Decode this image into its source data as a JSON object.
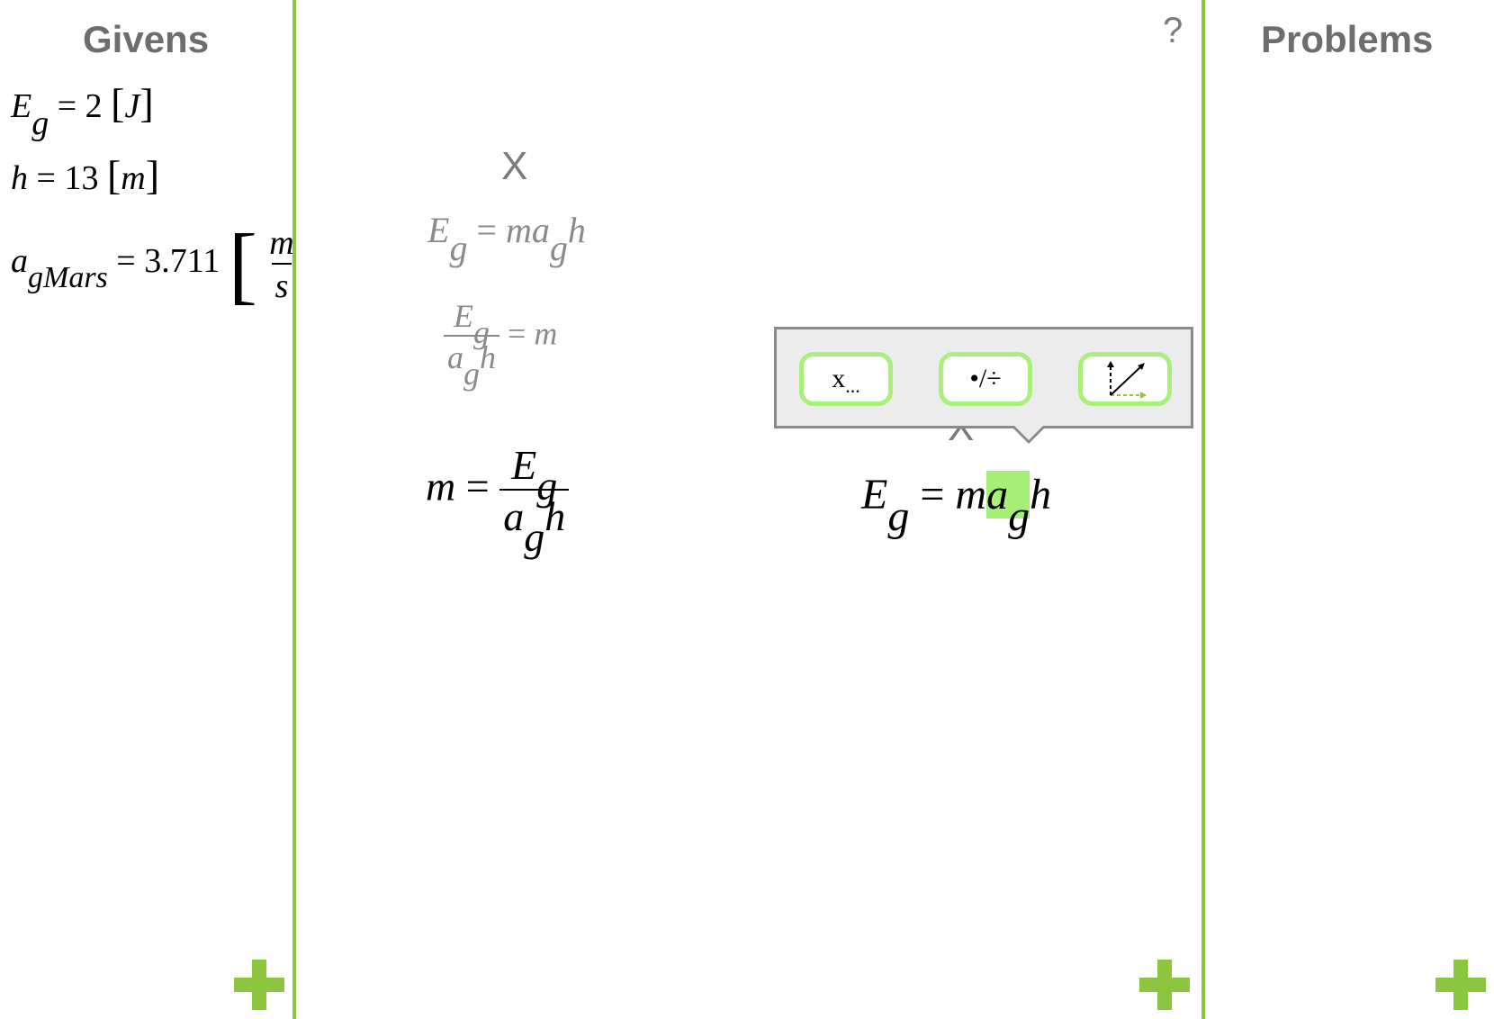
{
  "givens": {
    "title": "Givens",
    "items": [
      {
        "var": "E",
        "sub": "g",
        "eq": "=",
        "value": "2",
        "unit": "J"
      },
      {
        "var": "h",
        "sub": "",
        "eq": "=",
        "value": "13",
        "unit": "m"
      },
      {
        "var": "a",
        "sub": "gMars",
        "eq": "=",
        "value": "3.711",
        "unit_num": "m",
        "unit_den": "s"
      }
    ]
  },
  "problems": {
    "title": "Problems"
  },
  "help": {
    "label": "?"
  },
  "workspace": {
    "left_card": {
      "close": "X",
      "line1": {
        "lhs_var": "E",
        "lhs_sub": "g",
        "eq": "=",
        "rhs_a": "ma",
        "rhs_sub": "g",
        "rhs_b": "h"
      },
      "line2": {
        "num_var": "E",
        "num_sub": "g",
        "den_a": "a",
        "den_sub": "g",
        "den_b": "h",
        "eq": "=",
        "rhs": "m"
      },
      "line3": {
        "lhs": "m",
        "eq": "=",
        "num_var": "E",
        "num_sub": "g",
        "den_a": "a",
        "den_sub": "g",
        "den_b": "h"
      }
    },
    "right_card": {
      "close": "X",
      "equation": {
        "lhs_var": "E",
        "lhs_sub": "g",
        "eq": "=",
        "rhs_m": "m",
        "rhs_a": "a",
        "rhs_sub": "g",
        "rhs_h": "h"
      }
    },
    "toolbar": {
      "substitute_label": "x",
      "substitute_dots": "...",
      "muldiv_label": "•/÷",
      "graph_icon": "graph-arrow-icon"
    }
  },
  "colors": {
    "accent": "#8cc63f",
    "highlight": "#a6f07a",
    "title_gray": "#6d6d6d"
  }
}
